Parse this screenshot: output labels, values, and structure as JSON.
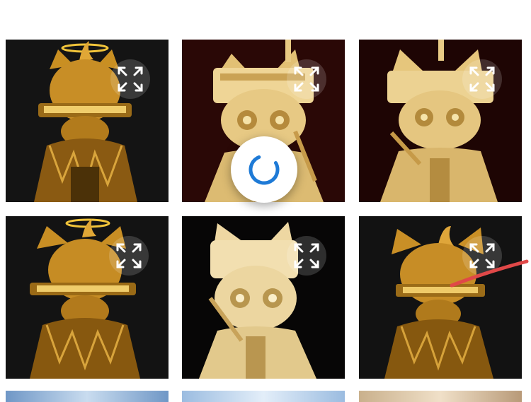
{
  "gallery": {
    "tiles": [
      {
        "variant": "halo-cat",
        "background": "#141414"
      },
      {
        "variant": "pale-robot-cat",
        "background": "#2a0806"
      },
      {
        "variant": "pale-robot-cat",
        "background": "#1e0504"
      },
      {
        "variant": "halo-cat",
        "background": "#131313"
      },
      {
        "variant": "pale-robot-cat",
        "background": "#070606"
      },
      {
        "variant": "mohawk-cat",
        "background": "#121212"
      }
    ],
    "expand_icon": "expand-arrows-icon",
    "loading": {
      "icon": "loading-spinner-icon",
      "color": "#1e7ad6"
    },
    "annotation_color": "#e04848",
    "peek_colors": [
      "#6f97c6",
      "#9bbce0",
      "#d8c2a4"
    ]
  }
}
